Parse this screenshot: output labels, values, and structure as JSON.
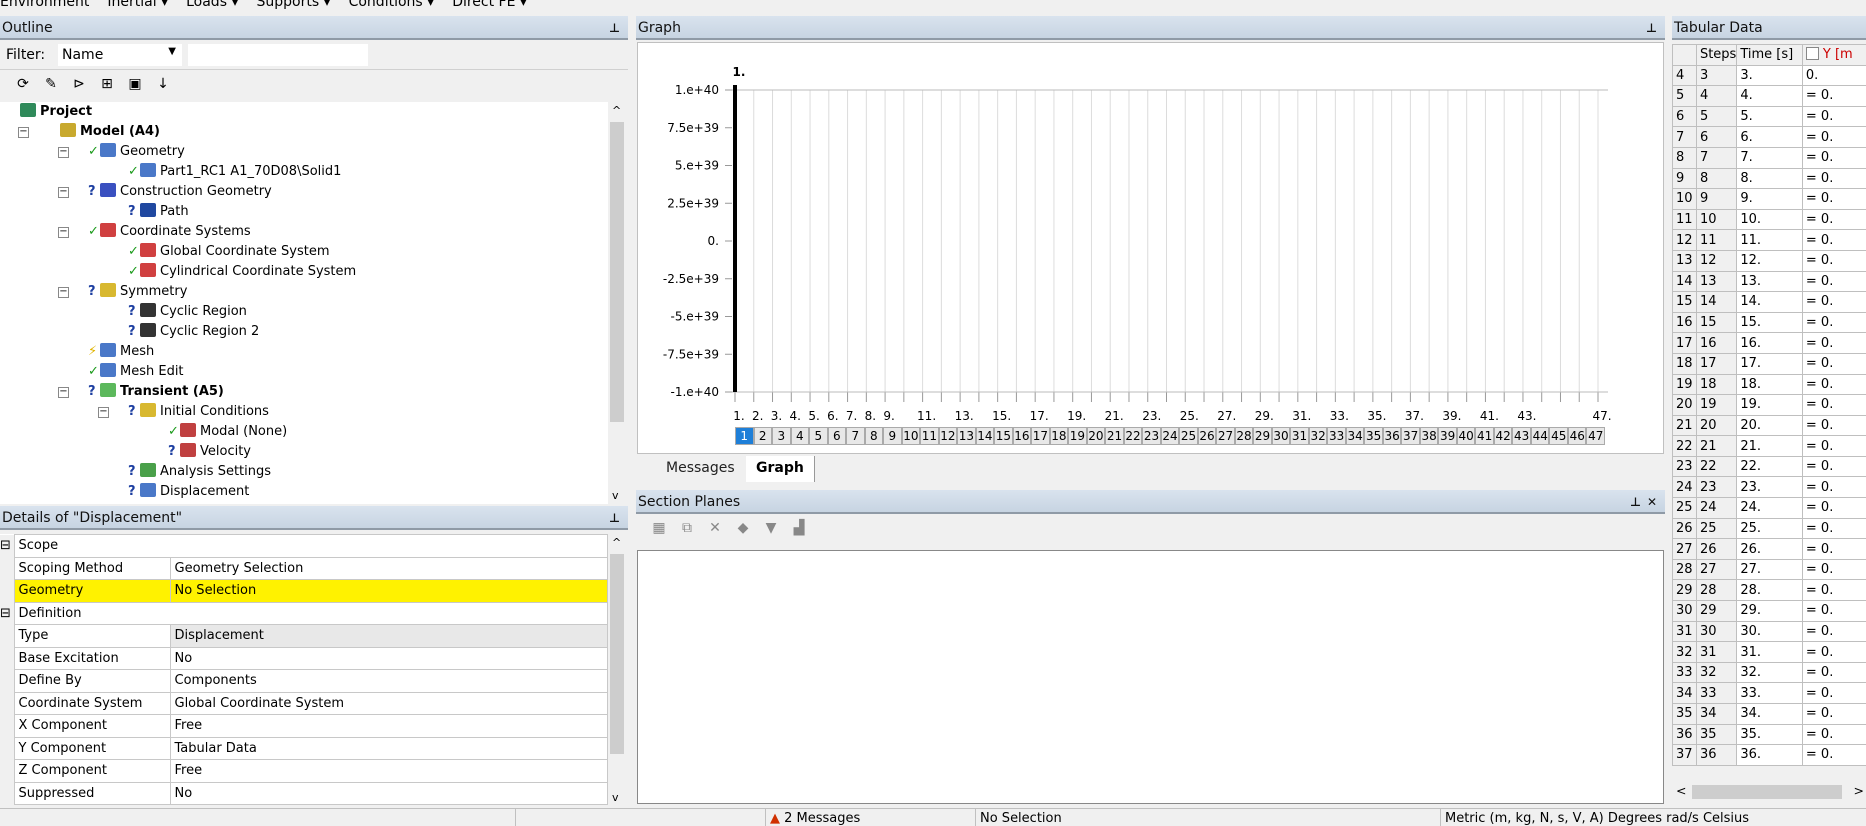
{
  "toolbar": {
    "items": [
      "Environment",
      "Inertial ▾",
      "Loads ▾",
      "Supports ▾",
      "Conditions ▾",
      "Direct FE ▾"
    ]
  },
  "outline": {
    "title": "Outline",
    "filter_label": "Filter:",
    "filter_value": "Name",
    "filter_text": "",
    "tools": [
      "refresh-icon",
      "clear-icon",
      "collapse-env-icon",
      "expand-all-icon",
      "folder-icon",
      "sort-az-icon"
    ],
    "tree": [
      {
        "label": "Project",
        "level": 0,
        "bold": true,
        "status": "",
        "icon": "#2f8a5a"
      },
      {
        "label": "Model (A4)",
        "level": 1,
        "bold": true,
        "status": "",
        "icon": "#c8a92e",
        "exp": true
      },
      {
        "label": "Geometry",
        "level": 2,
        "status": "ok",
        "icon": "#4a78c8",
        "exp": true
      },
      {
        "label": "Part1_RC1 A1_70D08\\Solid1",
        "level": 3,
        "status": "ok",
        "icon": "#4a78c8"
      },
      {
        "label": "Construction Geometry",
        "level": 2,
        "status": "q",
        "icon": "#3a50c0",
        "exp": true
      },
      {
        "label": "Path",
        "level": 3,
        "status": "q",
        "icon": "#2048a0"
      },
      {
        "label": "Coordinate Systems",
        "level": 2,
        "status": "ok",
        "icon": "#d04040",
        "exp": true
      },
      {
        "label": "Global Coordinate System",
        "level": 3,
        "status": "ok",
        "icon": "#d04040"
      },
      {
        "label": "Cylindrical Coordinate System",
        "level": 3,
        "status": "ok",
        "icon": "#d04040"
      },
      {
        "label": "Symmetry",
        "level": 2,
        "status": "q",
        "icon": "#d8b830",
        "exp": true
      },
      {
        "label": "Cyclic Region",
        "level": 3,
        "status": "q",
        "icon": "#333"
      },
      {
        "label": "Cyclic Region 2",
        "level": 3,
        "status": "q",
        "icon": "#333"
      },
      {
        "label": "Mesh",
        "level": 2,
        "status": "bolt",
        "icon": "#4a78c8"
      },
      {
        "label": "Mesh Edit",
        "level": 2,
        "status": "ok",
        "icon": "#4a78c8"
      },
      {
        "label": "Transient (A5)",
        "level": 2,
        "bold": true,
        "status": "q",
        "icon": "#5cb85c",
        "exp": true
      },
      {
        "label": "Initial Conditions",
        "level": 3,
        "status": "q",
        "icon": "#d8b830",
        "exp": true
      },
      {
        "label": "Modal (None)",
        "level": 4,
        "status": "ok",
        "icon": "#c04040"
      },
      {
        "label": "Velocity",
        "level": 4,
        "status": "q",
        "icon": "#c04040"
      },
      {
        "label": "Analysis Settings",
        "level": 3,
        "status": "q",
        "icon": "#4aa04a"
      },
      {
        "label": "Displacement",
        "level": 3,
        "status": "q",
        "icon": "#4a78c8"
      }
    ]
  },
  "details": {
    "title": "Details of \"Displacement\"",
    "rows": [
      {
        "section": "Scope"
      },
      {
        "k": "Scoping Method",
        "v": "Geometry Selection"
      },
      {
        "k": "Geometry",
        "v": "No Selection",
        "highlight": "#fff200"
      },
      {
        "section": "Definition"
      },
      {
        "k": "Type",
        "v": "Displacement",
        "grey": true
      },
      {
        "k": "Base Excitation",
        "v": "No"
      },
      {
        "k": "Define By",
        "v": "Components"
      },
      {
        "k": "Coordinate System",
        "v": "Global Coordinate System"
      },
      {
        "k": "X Component",
        "v": "Free"
      },
      {
        "k": "Y Component",
        "v": "Tabular Data"
      },
      {
        "k": "Z Component",
        "v": "Free"
      },
      {
        "k": "Suppressed",
        "v": "No"
      }
    ]
  },
  "graph": {
    "title": "Graph",
    "tabs": [
      "Messages",
      "Graph"
    ],
    "active_tab": "Graph",
    "selected_step": 1
  },
  "chart_data": {
    "type": "line",
    "xlim": [
      1,
      47
    ],
    "ylim": [
      -1e+40,
      1e+40
    ],
    "y_ticks": [
      "1.e+40",
      "7.5e+39",
      "5.e+39",
      "2.5e+39",
      "0.",
      "-2.5e+39",
      "-5.e+39",
      "-7.5e+39",
      "-1.e+40"
    ],
    "y_tick_values": [
      1e+40,
      7.5e+39,
      5e+39,
      2.5e+39,
      0,
      -2.5e+39,
      -5e+39,
      -7.5e+39,
      -1e+40
    ],
    "x_ticks": [
      "1.",
      "2.",
      "3.",
      "4.",
      "5.",
      "6.",
      "7.",
      "8.",
      "9.",
      "11.",
      "13.",
      "15.",
      "17.",
      "19.",
      "21.",
      "23.",
      "25.",
      "27.",
      "29.",
      "31.",
      "33.",
      "35.",
      "37.",
      "39.",
      "41.",
      "43.",
      "47."
    ],
    "x_tick_values": [
      1,
      2,
      3,
      4,
      5,
      6,
      7,
      8,
      9,
      11,
      13,
      15,
      17,
      19,
      21,
      23,
      25,
      27,
      29,
      31,
      33,
      35,
      37,
      39,
      41,
      43,
      47
    ],
    "marker": {
      "x": 1,
      "label": "1."
    },
    "grid": true,
    "steps": [
      1,
      2,
      3,
      4,
      5,
      6,
      7,
      8,
      9,
      10,
      11,
      12,
      13,
      14,
      15,
      16,
      17,
      18,
      19,
      20,
      21,
      22,
      23,
      24,
      25,
      26,
      27,
      28,
      29,
      30,
      31,
      32,
      33,
      34,
      35,
      36,
      37,
      38,
      39,
      40,
      41,
      42,
      43,
      44,
      45,
      46,
      47
    ]
  },
  "section_planes": {
    "title": "Section Planes",
    "tools": [
      "new-section-plane-icon",
      "copy-icon",
      "delete-icon",
      "show-plane-icon",
      "cap-icon",
      "cap-edges-icon"
    ]
  },
  "tabular": {
    "title": "Tabular Data",
    "columns": [
      "",
      "Steps",
      "Time [s]",
      "Y [m"
    ],
    "y_color": "#cc0000",
    "rows": [
      [
        "4",
        "3",
        "3.",
        "0."
      ],
      [
        "5",
        "4",
        "4.",
        "= 0."
      ],
      [
        "6",
        "5",
        "5.",
        "= 0."
      ],
      [
        "7",
        "6",
        "6.",
        "= 0."
      ],
      [
        "8",
        "7",
        "7.",
        "= 0."
      ],
      [
        "9",
        "8",
        "8.",
        "= 0."
      ],
      [
        "10",
        "9",
        "9.",
        "= 0."
      ],
      [
        "11",
        "10",
        "10.",
        "= 0."
      ],
      [
        "12",
        "11",
        "11.",
        "= 0."
      ],
      [
        "13",
        "12",
        "12.",
        "= 0."
      ],
      [
        "14",
        "13",
        "13.",
        "= 0."
      ],
      [
        "15",
        "14",
        "14.",
        "= 0."
      ],
      [
        "16",
        "15",
        "15.",
        "= 0."
      ],
      [
        "17",
        "16",
        "16.",
        "= 0."
      ],
      [
        "18",
        "17",
        "17.",
        "= 0."
      ],
      [
        "19",
        "18",
        "18.",
        "= 0."
      ],
      [
        "20",
        "19",
        "19.",
        "= 0."
      ],
      [
        "21",
        "20",
        "20.",
        "= 0."
      ],
      [
        "22",
        "21",
        "21.",
        "= 0."
      ],
      [
        "23",
        "22",
        "22.",
        "= 0."
      ],
      [
        "24",
        "23",
        "23.",
        "= 0."
      ],
      [
        "25",
        "24",
        "24.",
        "= 0."
      ],
      [
        "26",
        "25",
        "25.",
        "= 0."
      ],
      [
        "27",
        "26",
        "26.",
        "= 0."
      ],
      [
        "28",
        "27",
        "27.",
        "= 0."
      ],
      [
        "29",
        "28",
        "28.",
        "= 0."
      ],
      [
        "30",
        "29",
        "29.",
        "= 0."
      ],
      [
        "31",
        "30",
        "30.",
        "= 0."
      ],
      [
        "32",
        "31",
        "31.",
        "= 0."
      ],
      [
        "33",
        "32",
        "32.",
        "= 0."
      ],
      [
        "34",
        "33",
        "33.",
        "= 0."
      ],
      [
        "35",
        "34",
        "34.",
        "= 0."
      ],
      [
        "36",
        "35",
        "35.",
        "= 0."
      ],
      [
        "37",
        "36",
        "36.",
        "= 0."
      ]
    ]
  },
  "status": {
    "messages": "2 Messages",
    "selection": "No Selection",
    "units": "Metric (m, kg, N, s, V, A)   Degrees   rad/s   Celsius"
  }
}
